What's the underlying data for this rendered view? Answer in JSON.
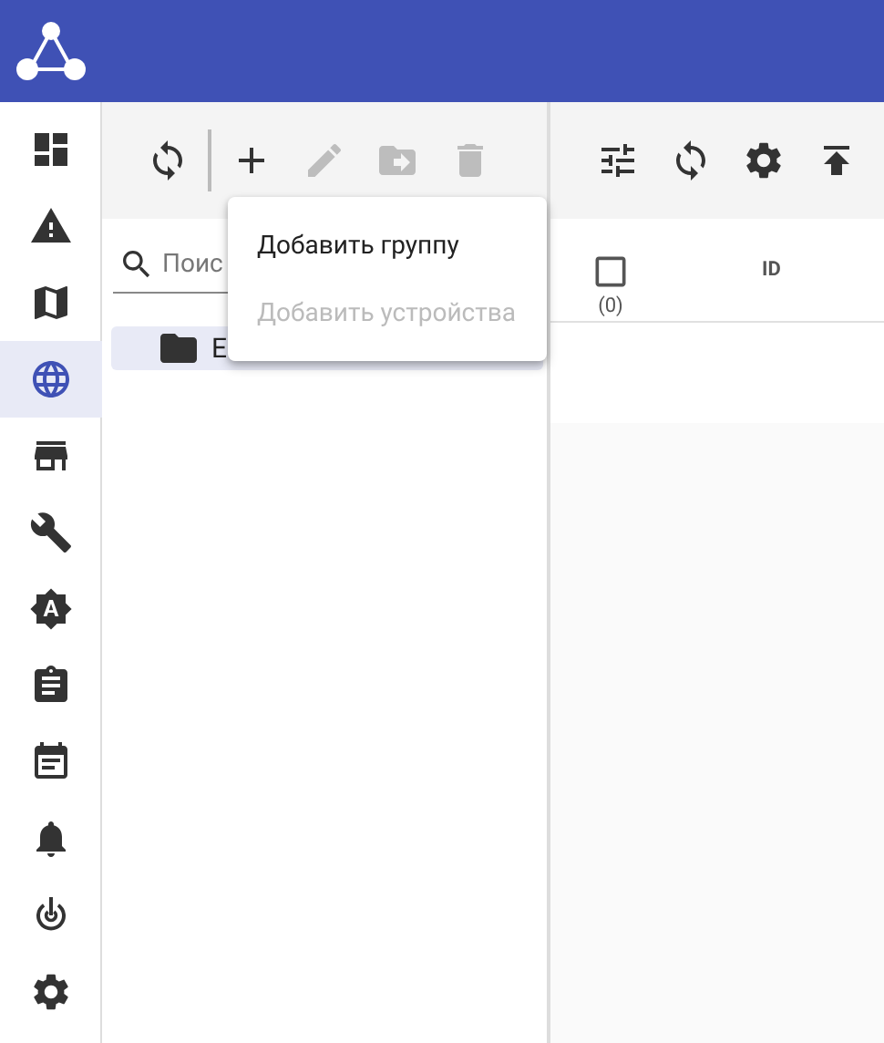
{
  "sidebar": {
    "items": [
      {
        "selected": false
      },
      {
        "selected": false
      },
      {
        "selected": false
      },
      {
        "selected": true
      },
      {
        "selected": false
      },
      {
        "selected": false
      },
      {
        "selected": false
      },
      {
        "selected": false
      },
      {
        "selected": false
      },
      {
        "selected": false
      },
      {
        "selected": false
      },
      {
        "selected": false
      }
    ]
  },
  "groups_panel": {
    "toolbar": [
      {
        "disabled": false
      },
      {
        "disabled": false
      },
      {
        "disabled": true
      },
      {
        "disabled": true
      },
      {
        "disabled": true
      }
    ],
    "search": {
      "placeholder": "Поис"
    },
    "tree": [
      {
        "label": "Е",
        "selected": true
      }
    ]
  },
  "add_menu": {
    "items": [
      {
        "label": "Добавить группу",
        "disabled": false
      },
      {
        "label": "Добавить устройства",
        "disabled": true
      }
    ]
  },
  "devices_panel": {
    "toolbar": [
      {
        "disabled": false
      },
      {
        "disabled": false
      },
      {
        "disabled": false
      },
      {
        "disabled": false
      }
    ],
    "table": {
      "select_all": {
        "checked": false,
        "count": "(0)"
      },
      "columns": [
        "ID"
      ]
    }
  }
}
